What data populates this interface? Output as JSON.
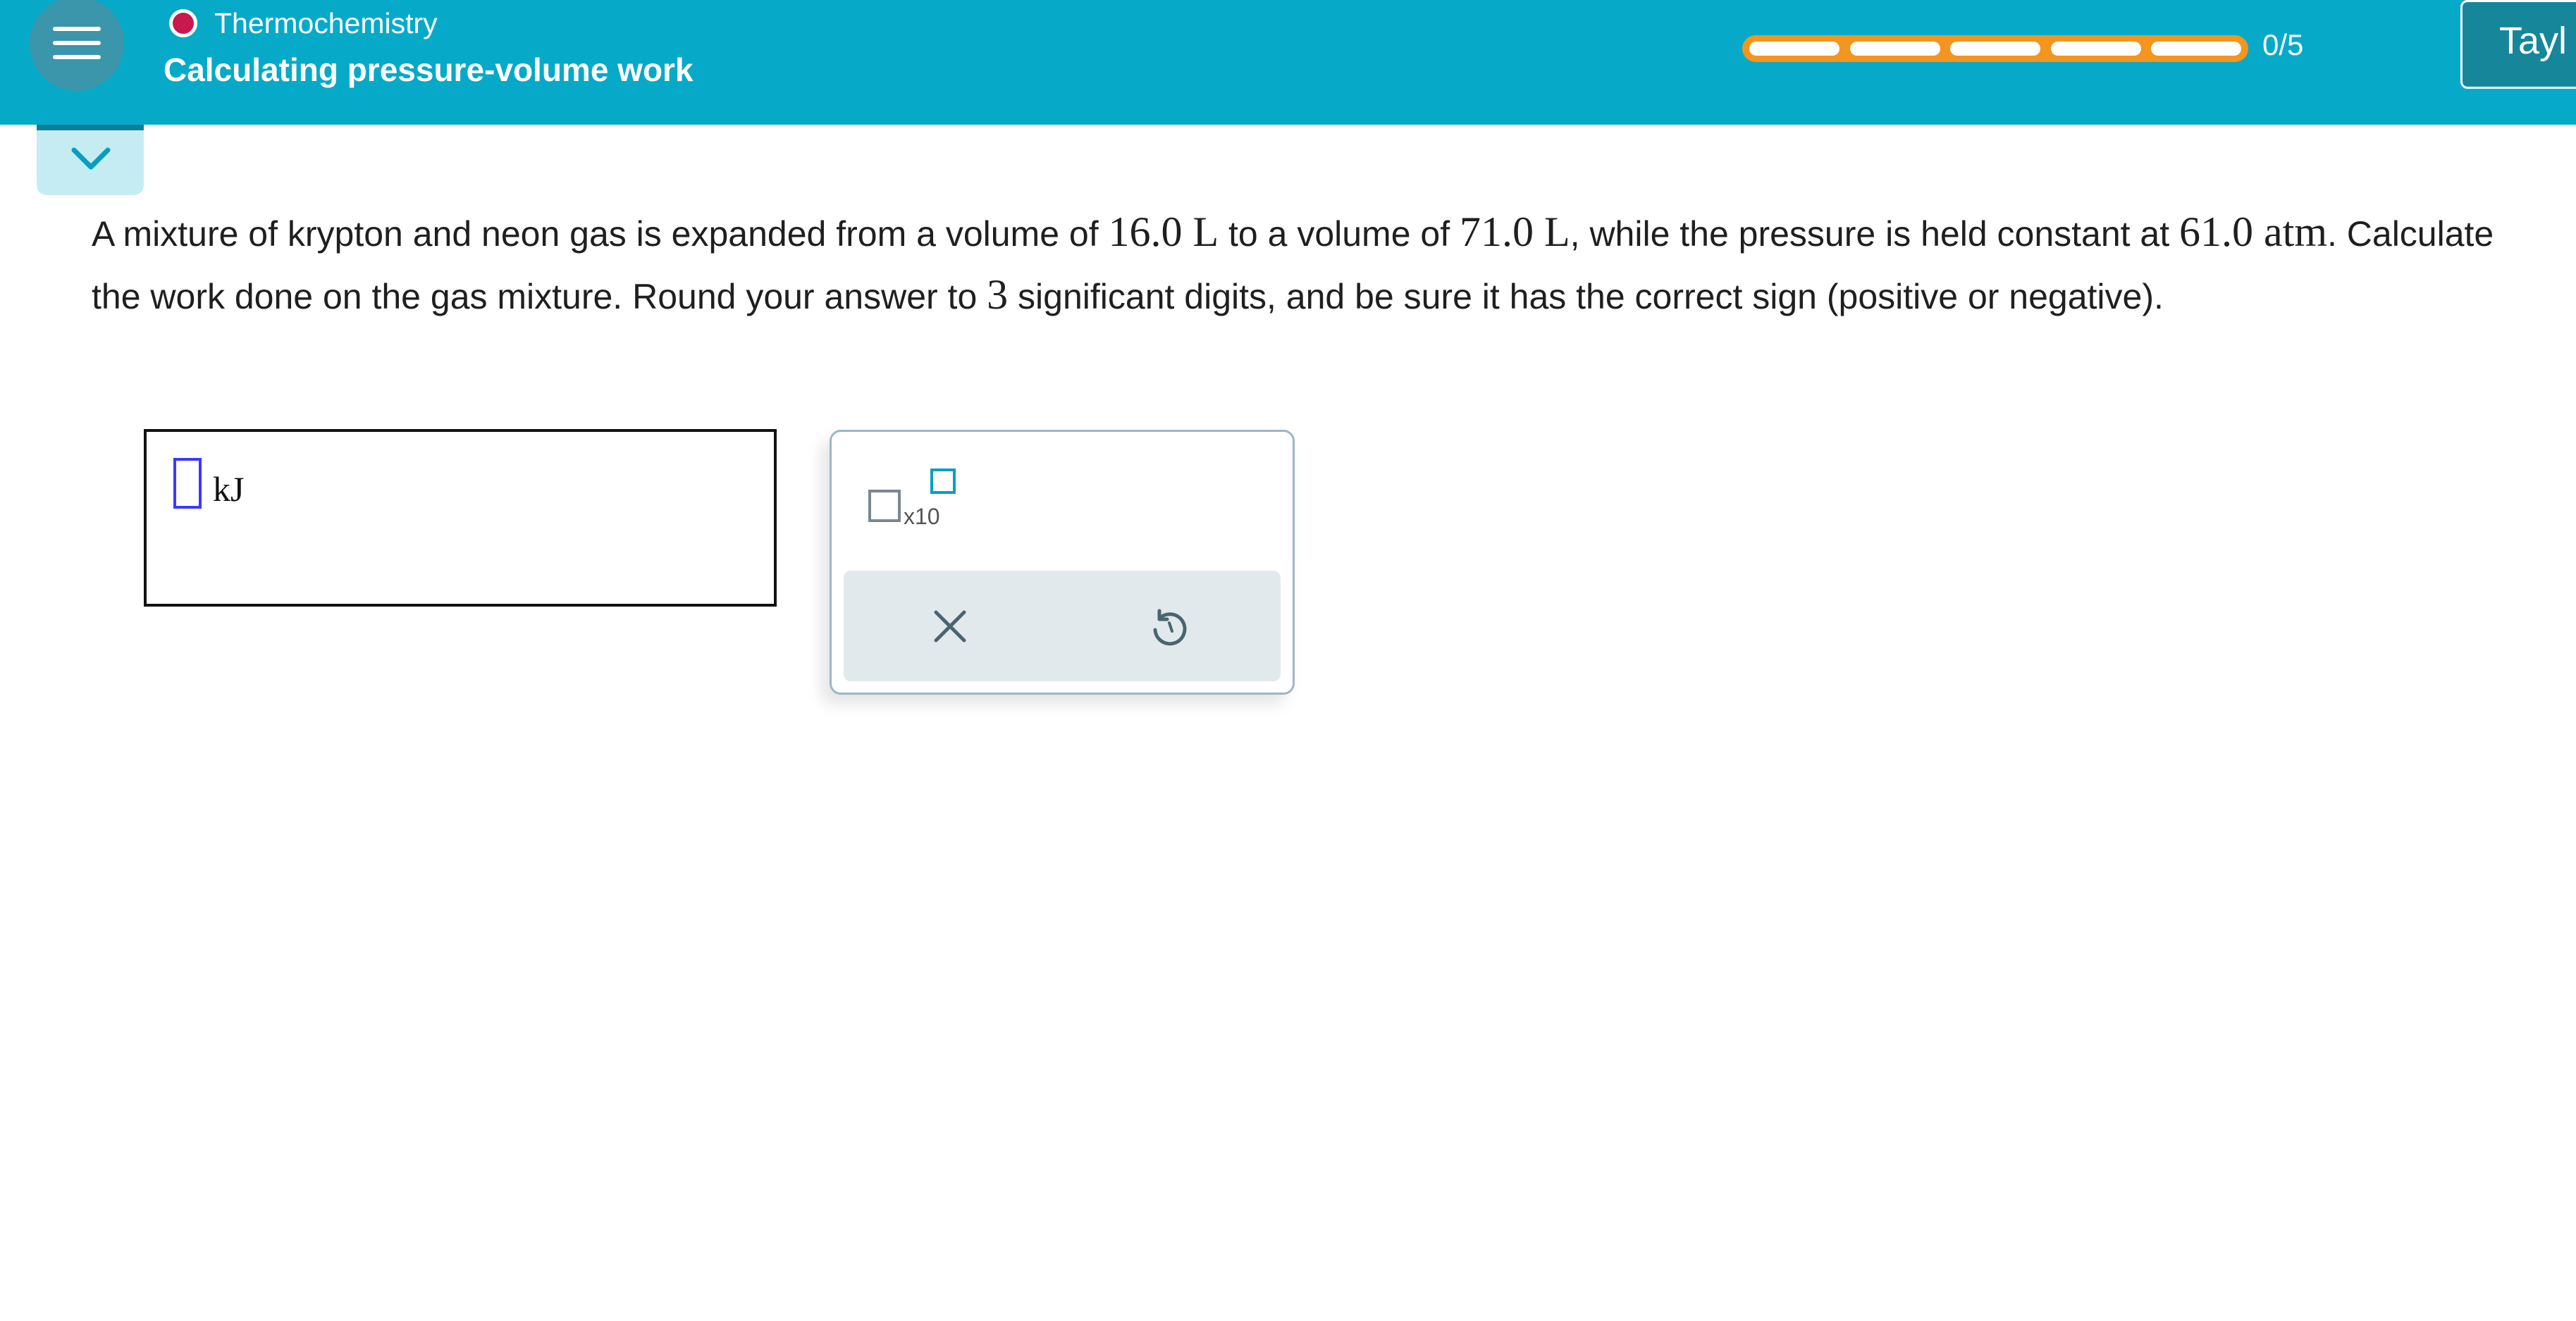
{
  "header": {
    "menu_icon": "hamburger-menu-icon",
    "topic": "Thermochemistry",
    "topic_status_color": "#c8194f",
    "lesson_title": "Calculating pressure-volume work",
    "progress": {
      "completed": 0,
      "total": 5,
      "label": "0/5"
    },
    "user_label": "Tayl",
    "accent_color": "#06aac8",
    "progress_color": "#f3951e"
  },
  "collapse_tab": {
    "icon": "chevron-down-icon"
  },
  "question": {
    "t1": "A mixture of krypton and neon gas is expanded from a volume of ",
    "v1": "16.0 L",
    "t2": " to a volume of ",
    "v2": "71.0 L",
    "t3": ", while the pressure is held constant at ",
    "p": "61.0 atm",
    "t4": ". Calculate the work done on the gas mixture. Round your answer to ",
    "sig": "3",
    "t5": " significant digits, and be sure it has the correct sign (positive or negative)."
  },
  "answer": {
    "value": "",
    "unit": "kJ"
  },
  "palette": {
    "sci_notation_label": "x10",
    "clear_icon": "close-icon",
    "undo_icon": "undo-icon"
  }
}
